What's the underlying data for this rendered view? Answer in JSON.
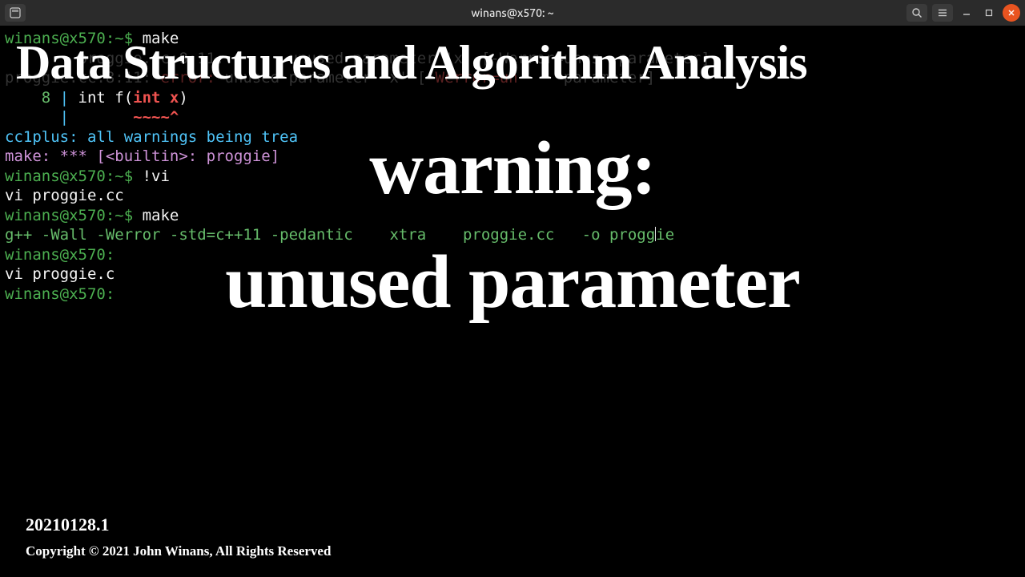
{
  "window": {
    "title": "winans@x570: ~"
  },
  "term": {
    "l1_prompt": "winans@x570:~$ ",
    "l1_cmd": "make",
    "l2_faded": "        proggie.cc:8:11:       unused parameter 'x' [-Werror=unus  parameter]",
    "l3_faded_a": "proggie.cc:8:11: ",
    "l3_faded_b": "error:",
    "l3_faded_c": " unused parameter 'x' [",
    "l3_faded_d": "-Werror=un",
    "l3_faded_e": "     parameter]",
    "l4_num": "    8 ",
    "l4_pipe": "| ",
    "l4_code_a": "int f(",
    "l4_code_b": "int x",
    "l4_code_c": ")",
    "l5_pipe": "      |       ",
    "l5_caret": "~~~~^",
    "l6": "cc1plus: all warnings being trea",
    "l7": "make: *** [<builtin>: proggie] ",
    "l8_prompt": "winans@x570:~$ ",
    "l8_cmd": "!vi",
    "l9": "vi proggie.cc",
    "l10_prompt": "winans@x570:~$ ",
    "l10_cmd": "make",
    "l11_a": "g++ -Wall -Werror -std=c++11 -pedantic    ",
    "l11_b": "xtra    proggie.cc   -o progg",
    "l11_c": "ie",
    "l12_prompt": "winans@x570:",
    "l13": "vi proggie.c",
    "l14_prompt": "winans@x570:"
  },
  "overlay": {
    "title": "Data Structures and Algorithm Analysis",
    "line1": "warning:",
    "line2": "unused parameter",
    "version": "20210128.1",
    "copyright": "Copyright © 2021 John Winans, All Rights Reserved"
  }
}
